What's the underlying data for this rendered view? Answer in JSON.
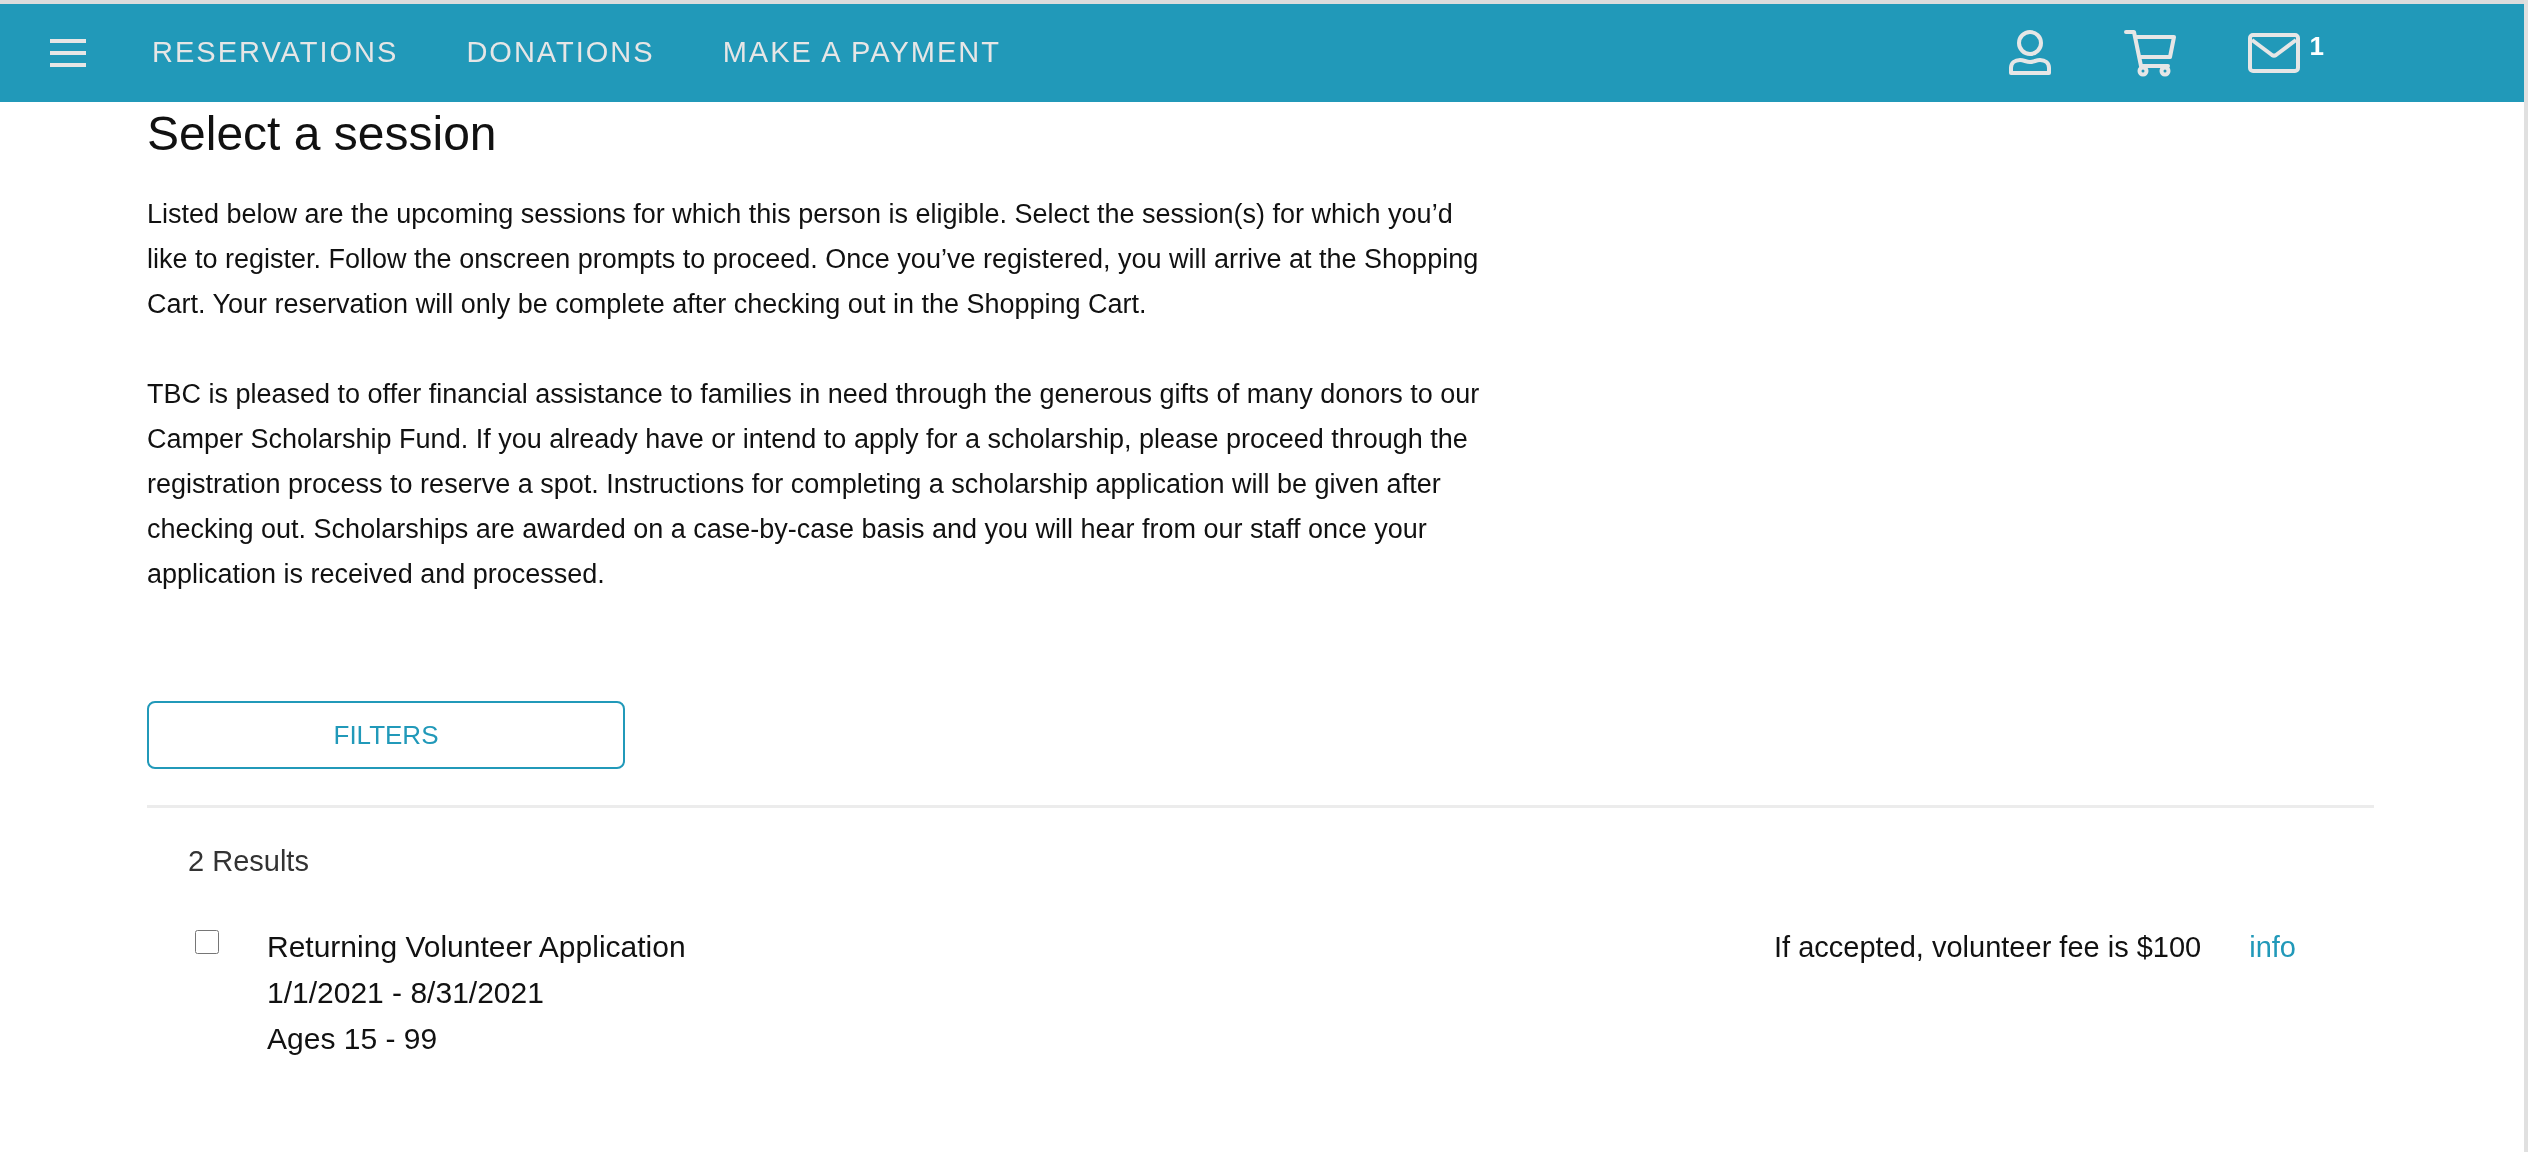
{
  "nav": {
    "items": [
      "RESERVATIONS",
      "DONATIONS",
      "MAKE A PAYMENT"
    ],
    "message_count": "1"
  },
  "page": {
    "title": "Select a session",
    "paragraphs": [
      "Listed below are the upcoming sessions for which this person is eligible. Select the session(s) for which you’d like to register. Follow the onscreen prompts to proceed. Once you’ve registered, you will arrive at the Shopping Cart. Your reservation will only be complete after checking out in the Shopping Cart.",
      "TBC is pleased to offer financial assistance to families in need through the generous gifts of many donors to our Camper Scholarship Fund. If you already have or intend to apply for a scholarship, please proceed through the registration process to reserve a spot. Instructions for completing a scholarship application will be given after checking out. Scholarships are awarded on a case-by-case basis and you will hear from our staff once your application is received and processed."
    ]
  },
  "filters_button": "FILTERS",
  "results": {
    "count": "2 Results",
    "sessions": [
      {
        "title": "Returning Volunteer Application",
        "dates": "1/1/2021 - 8/31/2021",
        "ages": "Ages 15 - 99",
        "note": "If accepted, volunteer fee is $100",
        "link": "info",
        "checked": false
      }
    ]
  }
}
